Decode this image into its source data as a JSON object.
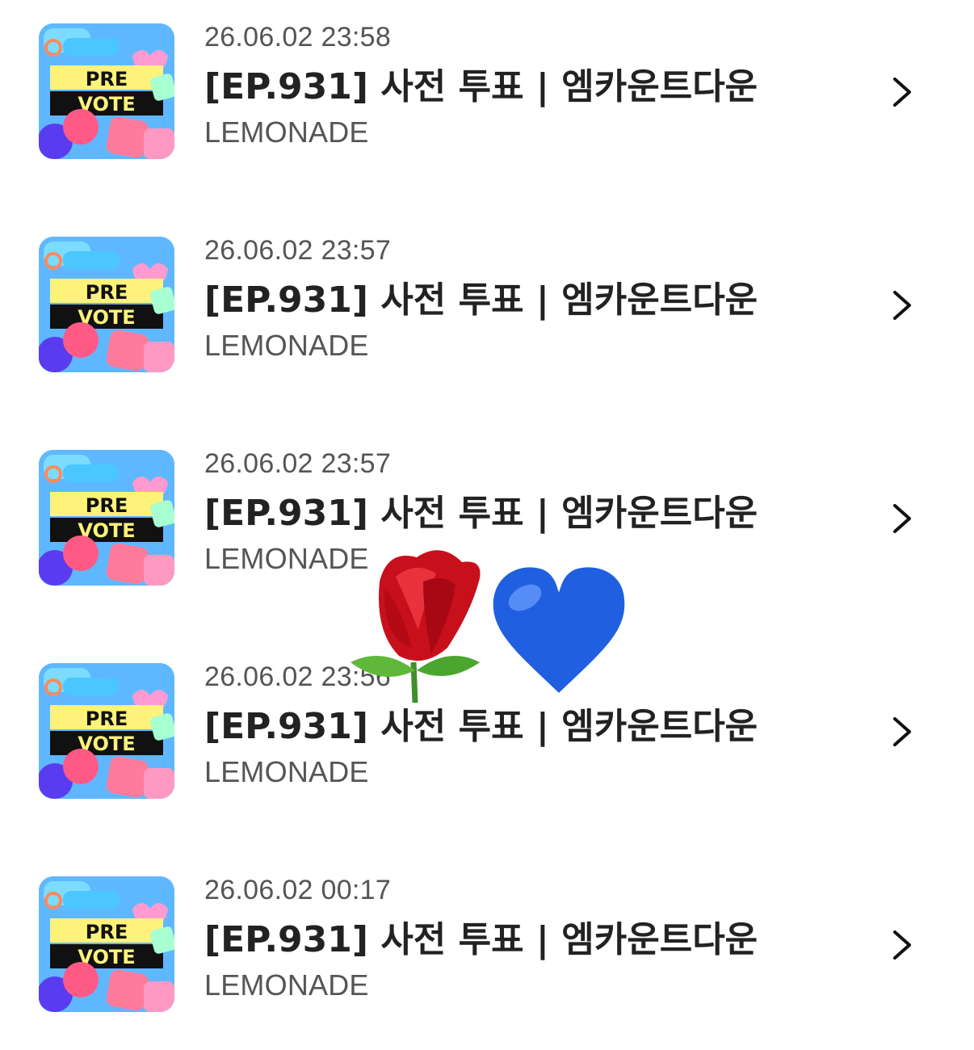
{
  "items": [
    {
      "date": "26.06.02 23:58",
      "title": "[EP.931] 사전 투표 | 엠카운트다운",
      "artist": "LEMONADE",
      "thumb_line1": "PRE",
      "thumb_line2": "VOTE"
    },
    {
      "date": "26.06.02 23:57",
      "title": "[EP.931] 사전 투표 | 엠카운트다운",
      "artist": "LEMONADE",
      "thumb_line1": "PRE",
      "thumb_line2": "VOTE"
    },
    {
      "date": "26.06.02 23:57",
      "title": "[EP.931] 사전 투표 | 엠카운트다운",
      "artist": "LEMONADE",
      "thumb_line1": "PRE",
      "thumb_line2": "VOTE"
    },
    {
      "date": "26.06.02 23:56",
      "title": "[EP.931] 사전 투표 | 엠카운트다운",
      "artist": "LEMONADE",
      "thumb_line1": "PRE",
      "thumb_line2": "VOTE"
    },
    {
      "date": "26.06.02 00:17",
      "title": "[EP.931] 사전 투표 | 엠카운트다운",
      "artist": "LEMONADE",
      "thumb_line1": "PRE",
      "thumb_line2": "VOTE"
    }
  ],
  "icons": {
    "row_action": "chevron-right-icon",
    "overlay_1": "rose-emoji",
    "overlay_2": "blue-heart-emoji"
  },
  "colors": {
    "text_primary": "#222222",
    "text_secondary": "#555555",
    "thumb_yellow": "#fff27a",
    "thumb_pink": "#ff6fa0",
    "heart_blue": "#1f5fe0",
    "rose_red": "#c8101c"
  }
}
